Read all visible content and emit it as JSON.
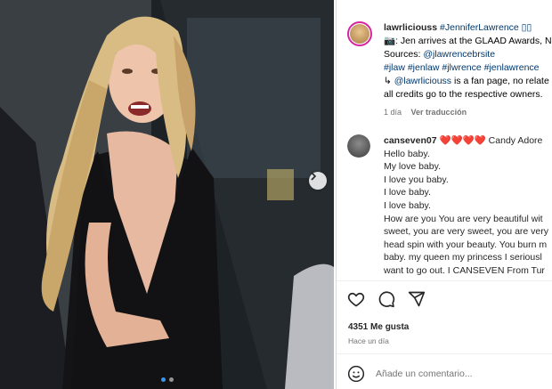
{
  "post": {
    "username": "lawrliciouss",
    "caption_line1_rest": " #JenniferLawrence ▯▯",
    "caption_line2": "📷: Jen arrives at the GLAAD Awards, N",
    "caption_line3_prefix": "Sources: ",
    "caption_line3_link": "@jlawrencebrsite",
    "caption_line4": "#jlaw #jenlaw #jlwrence #jenlawrence",
    "caption_line5_link": "@lawrliciouss",
    "caption_line5_rest": " is a fan page, no relate",
    "caption_line6": "all credits go to the respective owners.",
    "caption_line5_prefix": "↳ ",
    "time": "1 día",
    "see_translation": "Ver traducción"
  },
  "comment": {
    "username": "canseven07",
    "hearts": "❤️❤️❤️❤️",
    "first_line_rest": " Candy Adore",
    "lines": [
      "Hello baby.",
      "My love baby.",
      "I love you baby.",
      "I love baby.",
      "I love baby.",
      "How are you You are very beautiful wit",
      "sweet, you are very sweet, you are very",
      "head spin with your beauty. You burn m",
      "baby. my queen my princess I seriousl",
      "want to go out. I CANSEVEN From Tur"
    ]
  },
  "actions": {
    "like_icon": "heart-icon",
    "comment_icon": "comment-icon",
    "share_icon": "send-icon"
  },
  "likes_text": "4351 Me gusta",
  "posted_ago": "Hace un día",
  "add_comment": {
    "placeholder": "Añade un comentario..."
  },
  "emoji_icon": "smiley-icon",
  "carousel": {
    "slides": 2,
    "active_slide": 1
  },
  "colors": {
    "link": "#00376b",
    "muted": "#737373",
    "heart": "#ed1c24",
    "active_dot": "#3897f0"
  }
}
